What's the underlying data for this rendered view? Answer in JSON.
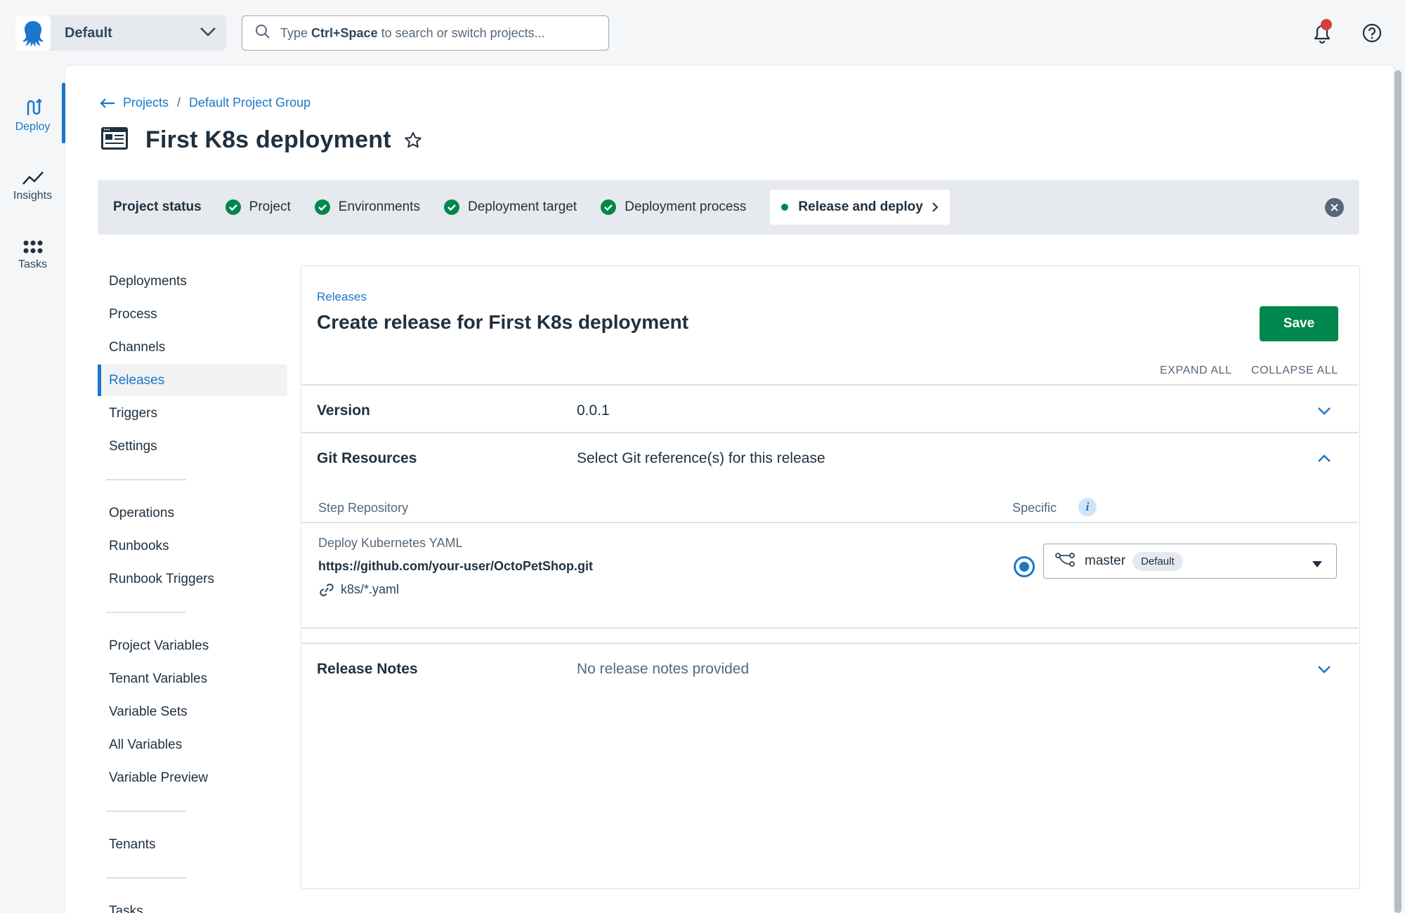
{
  "space": {
    "name": "Default"
  },
  "search": {
    "prefix": "Type ",
    "shortcut": "Ctrl+Space",
    "suffix": " to search or switch projects..."
  },
  "leftnav": [
    {
      "label": "Deploy",
      "icon": "deploy-icon"
    },
    {
      "label": "Insights",
      "icon": "insights-icon"
    },
    {
      "label": "Tasks",
      "icon": "tasks-icon"
    }
  ],
  "breadcrumb": {
    "projects": "Projects",
    "separator": "/",
    "group": "Default Project Group"
  },
  "page": {
    "title": "First K8s deployment"
  },
  "status": {
    "label": "Project status",
    "steps": [
      "Project",
      "Environments",
      "Deployment target",
      "Deployment process"
    ],
    "current": "Release and deploy"
  },
  "subnav": {
    "group1": [
      "Deployments",
      "Process",
      "Channels",
      "Releases",
      "Triggers",
      "Settings"
    ],
    "group2": [
      "Operations",
      "Runbooks",
      "Runbook Triggers"
    ],
    "group3": [
      "Project Variables",
      "Tenant Variables",
      "Variable Sets",
      "All Variables",
      "Variable Preview"
    ],
    "group4": [
      "Tenants"
    ],
    "group5": [
      "Tasks"
    ]
  },
  "card": {
    "crumb": "Releases",
    "title": "Create release for First K8s deployment",
    "save_label": "Save",
    "expand_all": "EXPAND ALL",
    "collapse_all": "COLLAPSE ALL",
    "version": {
      "label": "Version",
      "value": "0.0.1"
    },
    "git": {
      "label": "Git Resources",
      "value": "Select Git reference(s) for this release",
      "col_repo": "Step Repository",
      "col_specific": "Specific",
      "step_name": "Deploy Kubernetes YAML",
      "repo_url": "https://github.com/your-user/OctoPetShop.git",
      "path": "k8s/*.yaml",
      "branch": "master",
      "branch_badge": "Default"
    },
    "notes": {
      "label": "Release Notes",
      "value": "No release notes provided"
    }
  },
  "colors": {
    "accent": "#1a77ca",
    "success": "#00874d",
    "alert": "#d63d3d"
  }
}
